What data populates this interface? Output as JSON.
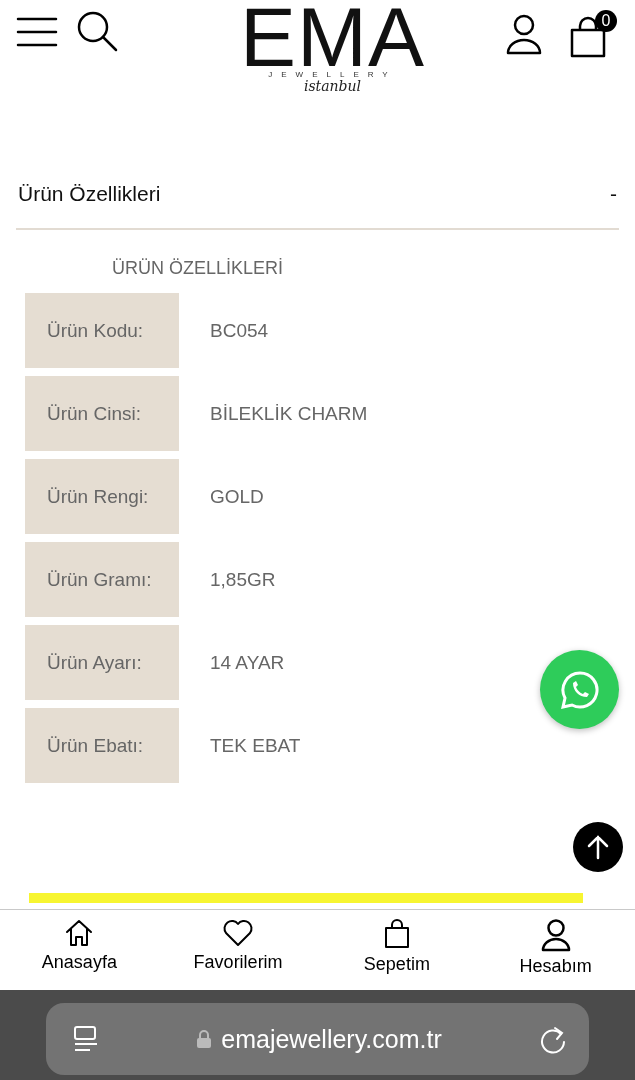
{
  "header": {
    "logo": {
      "brand": "EMA",
      "tagline": "JEWELLERY",
      "city": "istanbul"
    },
    "cart_count": "0"
  },
  "accordion": {
    "title": "Ürün Özellikleri",
    "toggle": "-",
    "expanded": true
  },
  "specs": {
    "heading": "ÜRÜN ÖZELLİKLERİ",
    "rows": [
      {
        "label": "Ürün Kodu:",
        "value": "BC054"
      },
      {
        "label": "Ürün Cinsi:",
        "value": "BİLEKLİK CHARM"
      },
      {
        "label": "Ürün Rengi:",
        "value": "GOLD"
      },
      {
        "label": "Ürün Gramı:",
        "value": "1,85GR"
      },
      {
        "label": "Ürün Ayarı:",
        "value": "14 AYAR"
      },
      {
        "label": "Ürün Ebatı:",
        "value": "TEK EBAT"
      }
    ]
  },
  "bottom_nav": [
    {
      "kind": "home",
      "label": "Anasayfa"
    },
    {
      "kind": "heart",
      "label": "Favorilerim"
    },
    {
      "kind": "bag",
      "label": "Sepetim"
    },
    {
      "kind": "user",
      "label": "Hesabım"
    }
  ],
  "browser": {
    "url": "emajewellery.com.tr"
  }
}
